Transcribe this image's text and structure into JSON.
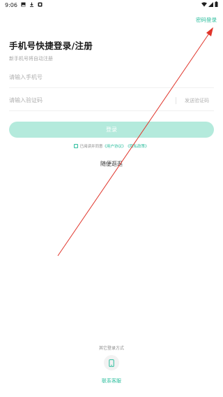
{
  "status_bar": {
    "time": "9:06",
    "icons": [
      "image-icon",
      "download-icon",
      "notification-icon"
    ],
    "right_icons": [
      "wifi-icon",
      "signal-icon",
      "battery-icon"
    ]
  },
  "header": {
    "password_login": "密码登录"
  },
  "title": "手机号快捷登录/注册",
  "subtitle": "新手机号将自动注册",
  "phone_field": {
    "placeholder": "请输入手机号"
  },
  "code_field": {
    "placeholder": "请输入验证码",
    "send_code": "发送验证码"
  },
  "login_button": "登录",
  "agreement": {
    "prefix": "已阅读并同意",
    "user_agreement": "《用户协议》",
    "privacy_policy": "《隐私政策》"
  },
  "browse_link": "随便逛逛",
  "footer": {
    "other_methods": "其它登录方式",
    "contact_support": "联系客服"
  },
  "colors": {
    "accent": "#2bbd9d",
    "button_disabled": "#b4eadc",
    "annotation": "#e0342a"
  }
}
